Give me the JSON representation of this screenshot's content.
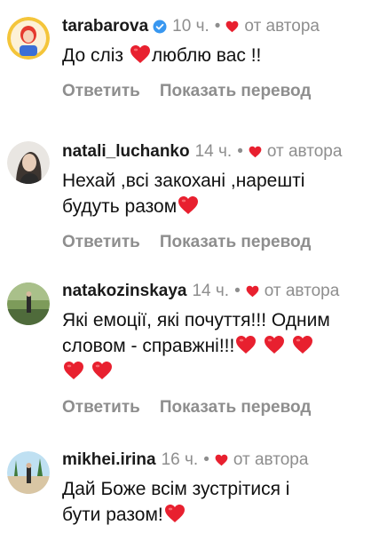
{
  "author_label": "от автора",
  "colors": {
    "heart": "#e8202f",
    "secondary_text": "#8e8e8e",
    "verified": "#3897f0"
  },
  "comments": [
    {
      "username": "tarabarova",
      "verified": true,
      "time": "10 ч.",
      "text_parts": [
        "До сліз ",
        "люблю вас !!"
      ],
      "reply": "Ответить",
      "translate": "Показать перевод"
    },
    {
      "username": "natali_luchanko",
      "verified": false,
      "time": "14 ч.",
      "text_line1": "Нехай ,всі закохані ,нарешті",
      "text_line2": "будуть разом",
      "reply": "Ответить",
      "translate": "Показать перевод"
    },
    {
      "username": "natakozinskaya",
      "verified": false,
      "time": "14 ч.",
      "text_line1": "Які емоції, які почуття!!! Одним",
      "text_line2": "словом - справжні!!!",
      "reply": "Ответить",
      "translate": "Показать перевод"
    },
    {
      "username": "mikhei.irina",
      "verified": false,
      "time": "16 ч.",
      "text_line1": "Дай Боже всім зустрітися і",
      "text_line2": "бути разом!"
    }
  ]
}
